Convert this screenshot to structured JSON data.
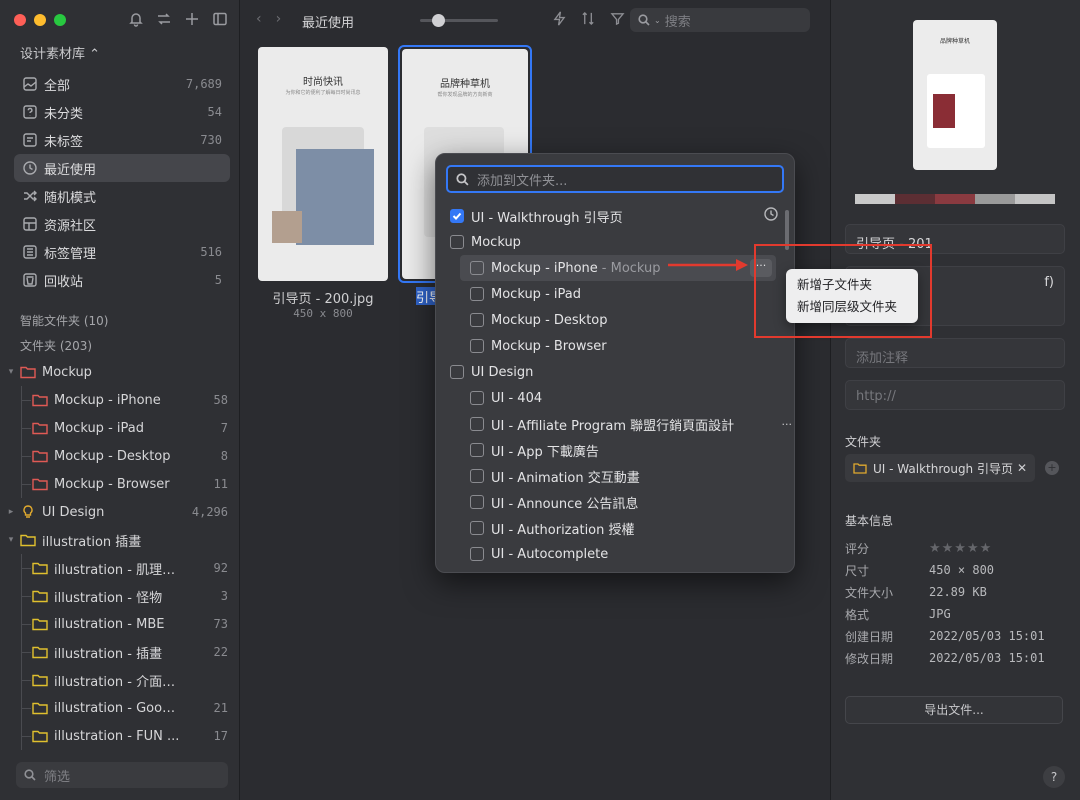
{
  "sidebar": {
    "library": "设计素材库 ⌃",
    "nav": [
      {
        "label": "全部",
        "count": "7,689",
        "icon": "image-icon"
      },
      {
        "label": "未分类",
        "count": "54",
        "icon": "question-box-icon"
      },
      {
        "label": "未标签",
        "count": "730",
        "icon": "tag-icon"
      },
      {
        "label": "最近使用",
        "count": "",
        "icon": "clock-icon"
      },
      {
        "label": "随机模式",
        "count": "",
        "icon": "shuffle-icon"
      },
      {
        "label": "资源社区",
        "count": "",
        "icon": "grid-icon"
      },
      {
        "label": "标签管理",
        "count": "516",
        "icon": "tags-icon"
      },
      {
        "label": "回收站",
        "count": "5",
        "icon": "trash-icon"
      }
    ],
    "smart_folders": "智能文件夹 (10)",
    "folders_title": "文件夹 (203)",
    "folders": [
      {
        "label": "Mockup",
        "count": "",
        "color": "#e05a55"
      },
      {
        "label": "Mockup - iPhone",
        "count": "58",
        "color": "#e05a55"
      },
      {
        "label": "Mockup - iPad",
        "count": "7",
        "color": "#e05a55"
      },
      {
        "label": "Mockup - Desktop",
        "count": "8",
        "color": "#e05a55"
      },
      {
        "label": "Mockup - Browser",
        "count": "11",
        "color": "#e05a55"
      },
      {
        "label": "UI Design",
        "count": "4,296",
        "color": "#e0a92e"
      },
      {
        "label": "illustration 插畫",
        "count": "",
        "color": "#e0c02e"
      },
      {
        "label": "illustration - 肌理插画",
        "count": "92",
        "color": "#e0c02e"
      },
      {
        "label": "illustration - 怪物",
        "count": "3",
        "color": "#e0c02e"
      },
      {
        "label": "illustration - MBE",
        "count": "73",
        "color": "#e0c02e"
      },
      {
        "label": "illustration - 插畫",
        "count": "22",
        "color": "#e0c02e"
      },
      {
        "label": "illustration - 介面插圖",
        "count": "",
        "color": "#e0c02e"
      },
      {
        "label": "illustration - Googl...",
        "count": "21",
        "color": "#e0c02e"
      },
      {
        "label": "illustration - FUN ...",
        "count": "17",
        "color": "#e0c02e"
      }
    ],
    "filter_placeholder": "筛选"
  },
  "toolbar": {
    "title": "最近使用",
    "search_placeholder": "搜索"
  },
  "thumbs": [
    {
      "card_title": "时尚快讯",
      "card_sub": "为你和它的便利了解每日时尚讯息",
      "name": "引导页 - 200.jpg",
      "dims": "450 x 800"
    },
    {
      "card_title": "品牌种草机",
      "card_sub": "帮你发现品牌的方向新商",
      "name": "引导页 - 201"
    }
  ],
  "popover": {
    "search_placeholder": "添加到文件夹...",
    "rows": [
      {
        "label": "UI - Walkthrough 引导页",
        "checked": true
      },
      {
        "label": "Mockup"
      },
      {
        "label": "Mockup - iPhone",
        "sub": "- Mockup"
      },
      {
        "label": "Mockup - iPad"
      },
      {
        "label": "Mockup - Desktop"
      },
      {
        "label": "Mockup - Browser"
      },
      {
        "label": "UI Design"
      },
      {
        "label": "UI - 404"
      },
      {
        "label": "UI - Affiliate Program 聯盟行銷頁面設計"
      },
      {
        "label": "UI - App 下載廣告"
      },
      {
        "label": "UI - Animation 交互動畫"
      },
      {
        "label": "UI - Announce 公告訊息"
      },
      {
        "label": "UI - Authorization 授權"
      },
      {
        "label": "UI - Autocomplete"
      }
    ],
    "more": "···",
    "context_menu": [
      "新增子文件夹",
      "新增同层级文件夹"
    ]
  },
  "inspector": {
    "palette": [
      "#c9c9c9",
      "#5c2e33",
      "#8a3a40",
      "#9a9a9a",
      "#c4c4c4"
    ],
    "name": "引导页 - 201",
    "description_tail": "f)",
    "note_placeholder": "添加注释",
    "url_placeholder": "http://",
    "folder_label": "文件夹",
    "folder_tag": "UI - Walkthrough 引导页",
    "basic_info": "基本信息",
    "info": [
      {
        "k": "评分",
        "v": "★★★★★"
      },
      {
        "k": "尺寸",
        "v": "450 × 800"
      },
      {
        "k": "文件大小",
        "v": "22.89 KB"
      },
      {
        "k": "格式",
        "v": "JPG"
      },
      {
        "k": "创建日期",
        "v": "2022/05/03 15:01"
      },
      {
        "k": "修改日期",
        "v": "2022/05/03 15:01"
      }
    ],
    "export": "导出文件...",
    "help": "?"
  }
}
